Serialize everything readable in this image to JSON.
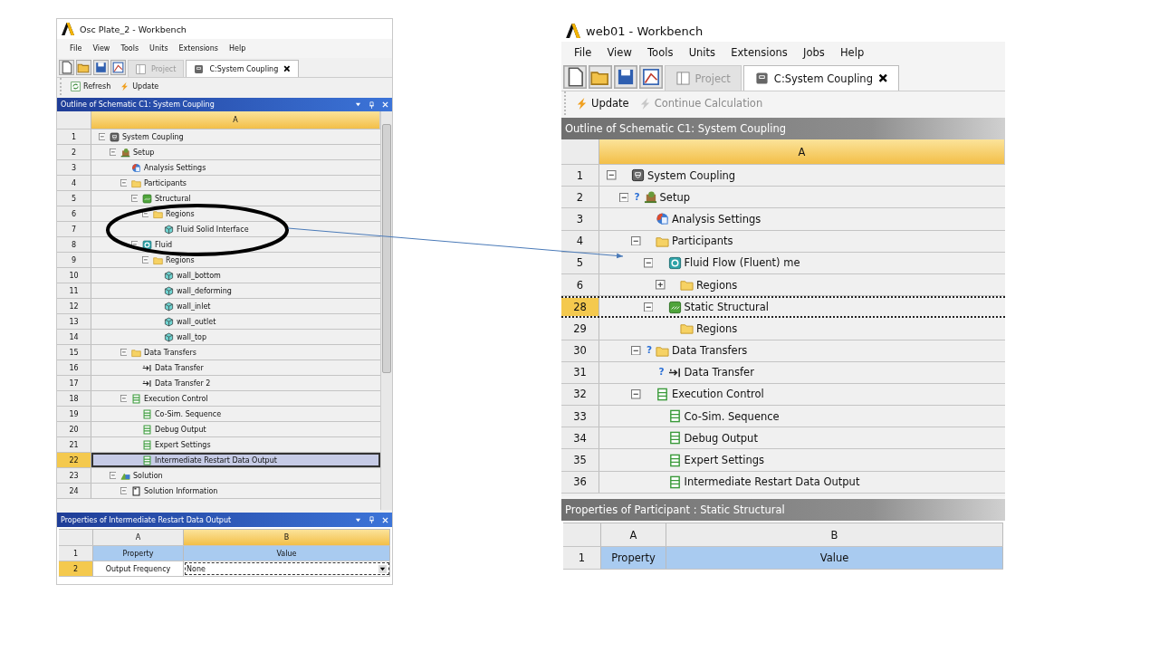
{
  "windows": [
    {
      "kind": "classic",
      "title": "Osc Plate_2 - Workbench",
      "menu": [
        "File",
        "View",
        "Tools",
        "Units",
        "Extensions",
        "Help"
      ],
      "tabs": [
        {
          "label": "Project",
          "selected": false
        },
        {
          "label": "C:System Coupling",
          "selected": true
        }
      ],
      "toolbar": [
        {
          "label": "Refresh",
          "kind": "refresh",
          "disabled": false
        },
        {
          "label": "Update",
          "kind": "update",
          "disabled": false
        }
      ],
      "outline": {
        "title": "Outline of Schematic C1: System Coupling",
        "column": "A",
        "tree": [
          {
            "row": "1",
            "label": "System Coupling",
            "kind": "coupling",
            "expanded": true,
            "selected": false,
            "children": [
              {
                "row": "2",
                "label": "Setup",
                "kind": "setup",
                "expanded": true,
                "selected": false,
                "children": [
                  {
                    "row": "3",
                    "label": "Analysis Settings",
                    "kind": "analysis",
                    "selected": false
                  },
                  {
                    "row": "4",
                    "label": "Participants",
                    "kind": "folder",
                    "expanded": true,
                    "selected": false,
                    "children": [
                      {
                        "row": "5",
                        "label": "Structural",
                        "kind": "structural",
                        "expanded": true,
                        "selected": false,
                        "children": [
                          {
                            "row": "6",
                            "label": "Regions",
                            "kind": "folder",
                            "expanded": true,
                            "selected": false,
                            "children": [
                              {
                                "row": "7",
                                "label": "Fluid Solid Interface",
                                "kind": "region",
                                "selected": false
                              }
                            ]
                          }
                        ]
                      },
                      {
                        "row": "8",
                        "label": "Fluid",
                        "kind": "fluid",
                        "expanded": true,
                        "selected": false,
                        "children": [
                          {
                            "row": "9",
                            "label": "Regions",
                            "kind": "folder",
                            "expanded": true,
                            "selected": false,
                            "children": [
                              {
                                "row": "10",
                                "label": "wall_bottom",
                                "kind": "region",
                                "selected": false
                              },
                              {
                                "row": "11",
                                "label": "wall_deforming",
                                "kind": "region",
                                "selected": false
                              },
                              {
                                "row": "12",
                                "label": "wall_inlet",
                                "kind": "region",
                                "selected": false
                              },
                              {
                                "row": "13",
                                "label": "wall_outlet",
                                "kind": "region",
                                "selected": false
                              },
                              {
                                "row": "14",
                                "label": "wall_top",
                                "kind": "region",
                                "selected": false
                              }
                            ]
                          }
                        ]
                      }
                    ]
                  },
                  {
                    "row": "15",
                    "label": "Data Transfers",
                    "kind": "folder",
                    "expanded": true,
                    "selected": false,
                    "children": [
                      {
                        "row": "16",
                        "label": "Data Transfer",
                        "kind": "transfer",
                        "selected": false
                      },
                      {
                        "row": "17",
                        "label": "Data Transfer 2",
                        "kind": "transfer",
                        "selected": false
                      }
                    ]
                  },
                  {
                    "row": "18",
                    "label": "Execution Control",
                    "kind": "control",
                    "expanded": true,
                    "selected": false,
                    "children": [
                      {
                        "row": "19",
                        "label": "Co-Sim. Sequence",
                        "kind": "control",
                        "selected": false
                      },
                      {
                        "row": "20",
                        "label": "Debug Output",
                        "kind": "control",
                        "selected": false
                      },
                      {
                        "row": "21",
                        "label": "Expert Settings",
                        "kind": "control",
                        "selected": false
                      },
                      {
                        "row": "22",
                        "label": "Intermediate Restart Data Output",
                        "kind": "control",
                        "selected": true
                      }
                    ]
                  }
                ]
              },
              {
                "row": "23",
                "label": "Solution",
                "kind": "solution",
                "expanded": true,
                "selected": false,
                "children": [
                  {
                    "row": "24",
                    "label": "Solution Information",
                    "kind": "info",
                    "expanded": true,
                    "selected": false
                  }
                ]
              }
            ]
          }
        ]
      },
      "properties": {
        "title": "Properties of Intermediate Restart Data Output",
        "columns": [
          "A",
          "B"
        ],
        "rows": [
          {
            "number": "1",
            "kind": "header",
            "property": "Property",
            "value": "Value",
            "selected": false
          },
          {
            "number": "2",
            "kind": "dropdown",
            "property": "Output Frequency",
            "value": "None",
            "selected": true
          }
        ]
      }
    },
    {
      "kind": "modern",
      "title": "web01 - Workbench",
      "menu": [
        "File",
        "View",
        "Tools",
        "Units",
        "Extensions",
        "Jobs",
        "Help"
      ],
      "tabs": [
        {
          "label": "Project",
          "selected": false
        },
        {
          "label": "C:System Coupling",
          "selected": true
        }
      ],
      "toolbar": [
        {
          "label": "Update",
          "kind": "update",
          "disabled": false
        },
        {
          "label": "Continue Calculation",
          "kind": "update",
          "disabled": true
        }
      ],
      "outline": {
        "title": "Outline of Schematic C1: System Coupling",
        "column": "A",
        "tree": [
          {
            "row": "1",
            "label": "System Coupling",
            "kind": "coupling",
            "expanded": true,
            "selected": false,
            "children": [
              {
                "row": "2",
                "label": "Setup",
                "kind": "setup",
                "expanded": true,
                "flag": "?",
                "selected": false,
                "children": [
                  {
                    "row": "3",
                    "label": "Analysis Settings",
                    "kind": "analysis",
                    "selected": false
                  },
                  {
                    "row": "4",
                    "label": "Participants",
                    "kind": "folder",
                    "expanded": true,
                    "selected": false,
                    "children": [
                      {
                        "row": "5",
                        "label": "Fluid Flow (Fluent) me",
                        "kind": "fluid",
                        "expanded": true,
                        "selected": false,
                        "children": [
                          {
                            "row": "6",
                            "label": "Regions",
                            "kind": "folder",
                            "expanded": false,
                            "selected": false
                          }
                        ]
                      },
                      {
                        "row": "28",
                        "label": "Static Structural",
                        "kind": "structural",
                        "expanded": true,
                        "selected": true,
                        "children": [
                          {
                            "row": "29",
                            "label": "Regions",
                            "kind": "folder",
                            "selected": false
                          }
                        ]
                      }
                    ]
                  },
                  {
                    "row": "30",
                    "label": "Data Transfers",
                    "kind": "folder",
                    "expanded": true,
                    "flag": "?",
                    "selected": false,
                    "children": [
                      {
                        "row": "31",
                        "label": "Data Transfer",
                        "kind": "transfer",
                        "flag": "?",
                        "selected": false
                      }
                    ]
                  },
                  {
                    "row": "32",
                    "label": "Execution Control",
                    "kind": "control",
                    "expanded": true,
                    "selected": false,
                    "children": [
                      {
                        "row": "33",
                        "label": "Co-Sim. Sequence",
                        "kind": "control",
                        "selected": false
                      },
                      {
                        "row": "34",
                        "label": "Debug Output",
                        "kind": "control",
                        "selected": false
                      },
                      {
                        "row": "35",
                        "label": "Expert Settings",
                        "kind": "control",
                        "selected": false
                      },
                      {
                        "row": "36",
                        "label": "Intermediate Restart Data Output",
                        "kind": "control",
                        "selected": false
                      }
                    ]
                  }
                ]
              }
            ]
          }
        ]
      },
      "properties": {
        "title": "Properties of Participant : Static Structural",
        "columns": [
          "A",
          "B"
        ],
        "rows": [
          {
            "number": "1",
            "kind": "header",
            "property": "Property",
            "value": "Value",
            "selected": false
          }
        ]
      }
    }
  ]
}
